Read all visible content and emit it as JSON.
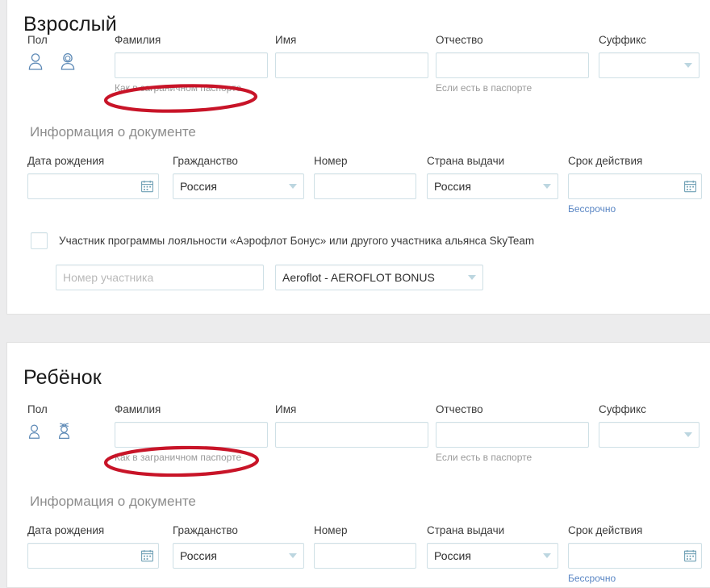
{
  "sections": [
    {
      "id": "adult",
      "title": "Взрослый",
      "name_row": {
        "gender_label": "Пол",
        "gender_options": [
          "male-icon",
          "female-icon"
        ],
        "fields": [
          {
            "label": "Фамилия",
            "value": "",
            "hint": "Как в заграничном паспорте",
            "annotated": true
          },
          {
            "label": "Имя",
            "value": "",
            "hint": ""
          },
          {
            "label": "Отчество",
            "value": "",
            "hint": "Если есть в паспорте"
          },
          {
            "label": "Суффикс",
            "value": "",
            "type": "select"
          }
        ]
      },
      "document": {
        "title": "Информация о документе",
        "fields": [
          {
            "label": "Дата рождения",
            "value": "",
            "type": "date"
          },
          {
            "label": "Гражданство",
            "value": "Россия",
            "type": "select"
          },
          {
            "label": "Номер",
            "value": "",
            "type": "text"
          },
          {
            "label": "Страна выдачи",
            "value": "Россия",
            "type": "select"
          },
          {
            "label": "Срок действия",
            "value": "",
            "type": "date",
            "hint": "Бессрочно",
            "hint_is_link": true
          }
        ]
      },
      "loyalty": {
        "checkbox_label": "Участник программы лояльности «Аэрофлот Бонус» или другого участника альянса SkyTeam",
        "checked": false,
        "number_placeholder": "Номер участника",
        "number_value": "",
        "program_value": "Aeroflot - AEROFLOT BONUS"
      }
    },
    {
      "id": "child",
      "title": "Ребёнок",
      "name_row": {
        "gender_label": "Пол",
        "gender_options": [
          "boy-icon",
          "girl-icon"
        ],
        "fields": [
          {
            "label": "Фамилия",
            "value": "",
            "hint": "Как в заграничном паспорте",
            "annotated": true
          },
          {
            "label": "Имя",
            "value": "",
            "hint": ""
          },
          {
            "label": "Отчество",
            "value": "",
            "hint": "Если есть в паспорте"
          },
          {
            "label": "Суффикс",
            "value": "",
            "type": "select"
          }
        ]
      },
      "document": {
        "title": "Информация о документе",
        "fields": [
          {
            "label": "Дата рождения",
            "value": "",
            "type": "date"
          },
          {
            "label": "Гражданство",
            "value": "Россия",
            "type": "select"
          },
          {
            "label": "Номер",
            "value": "",
            "type": "text"
          },
          {
            "label": "Страна выдачи",
            "value": "Россия",
            "type": "select"
          },
          {
            "label": "Срок действия",
            "value": "",
            "type": "date",
            "hint": "Бессрочно",
            "hint_is_link": true
          }
        ]
      }
    }
  ],
  "annotations": {
    "color": "#c81428",
    "shape": "ellipse"
  }
}
